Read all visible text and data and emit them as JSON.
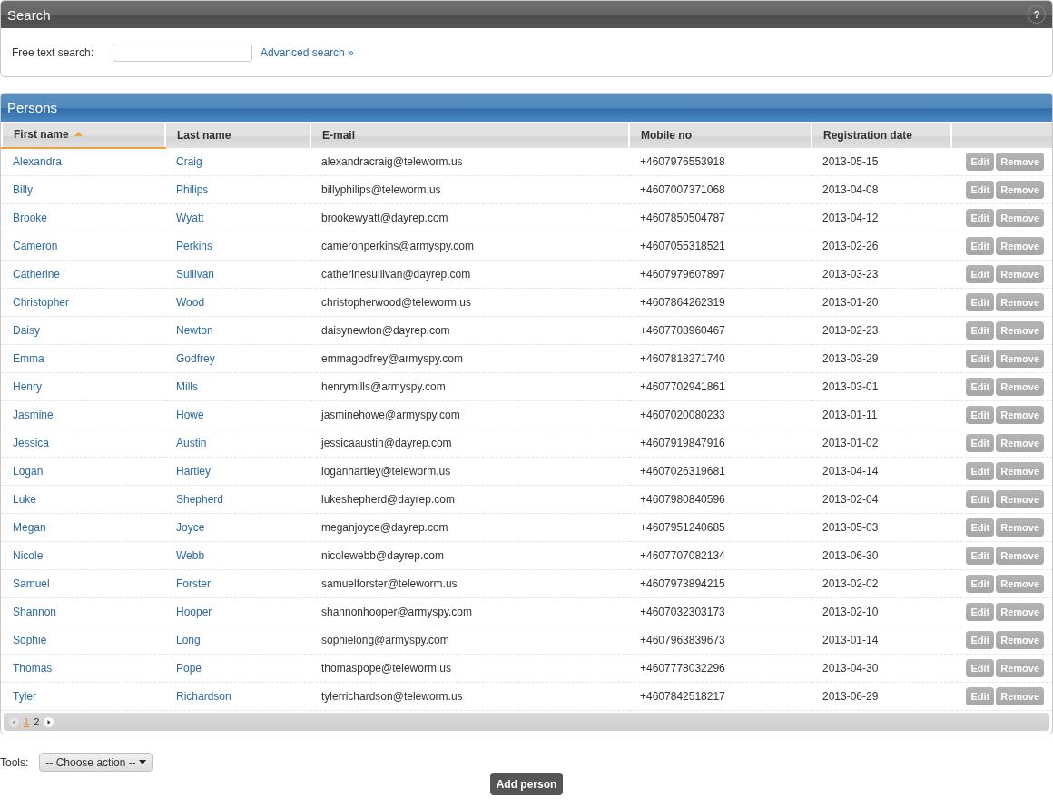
{
  "search_panel": {
    "title": "Search",
    "help": "?",
    "label": "Free text search:",
    "link": "Advanced search »"
  },
  "persons_panel": {
    "title": "Persons",
    "columns": [
      {
        "label": "First name",
        "sorted": true
      },
      {
        "label": "Last name",
        "sorted": false
      },
      {
        "label": "E-mail",
        "sorted": false
      },
      {
        "label": "Mobile no",
        "sorted": false
      },
      {
        "label": "Registration date",
        "sorted": false
      },
      {
        "sorted": false
      }
    ],
    "rows": [
      {
        "first": "Alexandra",
        "last": "Craig",
        "email": "alexandracraig@teleworm.us",
        "mobile": "+4607976553918",
        "date": "2013-05-15",
        "edit": "Edit",
        "remove": "Remove"
      },
      {
        "first": "Billy",
        "last": "Philips",
        "email": "billyphilips@teleworm.us",
        "mobile": "+4607007371068",
        "date": "2013-04-08",
        "edit": "Edit",
        "remove": "Remove"
      },
      {
        "first": "Brooke",
        "last": "Wyatt",
        "email": "brookewyatt@dayrep.com",
        "mobile": "+4607850504787",
        "date": "2013-04-12",
        "edit": "Edit",
        "remove": "Remove"
      },
      {
        "first": "Cameron",
        "last": "Perkins",
        "email": "cameronperkins@armyspy.com",
        "mobile": "+4607055318521",
        "date": "2013-02-26",
        "edit": "Edit",
        "remove": "Remove"
      },
      {
        "first": "Catherine",
        "last": "Sullivan",
        "email": "catherinesullivan@dayrep.com",
        "mobile": "+4607979607897",
        "date": "2013-03-23",
        "edit": "Edit",
        "remove": "Remove"
      },
      {
        "first": "Christopher",
        "last": "Wood",
        "email": "christopherwood@teleworm.us",
        "mobile": "+4607864262319",
        "date": "2013-01-20",
        "edit": "Edit",
        "remove": "Remove"
      },
      {
        "first": "Daisy",
        "last": "Newton",
        "email": "daisynewton@dayrep.com",
        "mobile": "+4607708960467",
        "date": "2013-02-23",
        "edit": "Edit",
        "remove": "Remove"
      },
      {
        "first": "Emma",
        "last": "Godfrey",
        "email": "emmagodfrey@armyspy.com",
        "mobile": "+4607818271740",
        "date": "2013-03-29",
        "edit": "Edit",
        "remove": "Remove"
      },
      {
        "first": "Henry",
        "last": "Mills",
        "email": "henrymills@armyspy.com",
        "mobile": "+4607702941861",
        "date": "2013-03-01",
        "edit": "Edit",
        "remove": "Remove"
      },
      {
        "first": "Jasmine",
        "last": "Howe",
        "email": "jasminehowe@armyspy.com",
        "mobile": "+4607020080233",
        "date": "2013-01-11",
        "edit": "Edit",
        "remove": "Remove"
      },
      {
        "first": "Jessica",
        "last": "Austin",
        "email": "jessicaaustin@dayrep.com",
        "mobile": "+4607919847916",
        "date": "2013-01-02",
        "edit": "Edit",
        "remove": "Remove"
      },
      {
        "first": "Logan",
        "last": "Hartley",
        "email": "loganhartley@teleworm.us",
        "mobile": "+4607026319681",
        "date": "2013-04-14",
        "edit": "Edit",
        "remove": "Remove"
      },
      {
        "first": "Luke",
        "last": "Shepherd",
        "email": "lukeshepherd@dayrep.com",
        "mobile": "+4607980840596",
        "date": "2013-02-04",
        "edit": "Edit",
        "remove": "Remove"
      },
      {
        "first": "Megan",
        "last": "Joyce",
        "email": "meganjoyce@dayrep.com",
        "mobile": "+4607951240685",
        "date": "2013-05-03",
        "edit": "Edit",
        "remove": "Remove"
      },
      {
        "first": "Nicole",
        "last": "Webb",
        "email": "nicolewebb@dayrep.com",
        "mobile": "+4607707082134",
        "date": "2013-06-30",
        "edit": "Edit",
        "remove": "Remove"
      },
      {
        "first": "Samuel",
        "last": "Forster",
        "email": "samuelforster@teleworm.us",
        "mobile": "+4607973894215",
        "date": "2013-02-02",
        "edit": "Edit",
        "remove": "Remove"
      },
      {
        "first": "Shannon",
        "last": "Hooper",
        "email": "shannonhooper@armyspy.com",
        "mobile": "+4607032303173",
        "date": "2013-02-10",
        "edit": "Edit",
        "remove": "Remove"
      },
      {
        "first": "Sophie",
        "last": "Long",
        "email": "sophielong@armyspy.com",
        "mobile": "+4607963839673",
        "date": "2013-01-14",
        "edit": "Edit",
        "remove": "Remove"
      },
      {
        "first": "Thomas",
        "last": "Pope",
        "email": "thomaspope@teleworm.us",
        "mobile": "+4607778032296",
        "date": "2013-04-30",
        "edit": "Edit",
        "remove": "Remove"
      },
      {
        "first": "Tyler",
        "last": "Richardson",
        "email": "tylerrichardson@teleworm.us",
        "mobile": "+4607842518217",
        "date": "2013-06-29",
        "edit": "Edit",
        "remove": "Remove"
      }
    ],
    "pages": [
      {
        "label": "1",
        "selected": true
      },
      {
        "label": "2",
        "selected": false
      }
    ]
  },
  "tools": {
    "label": "Tools:",
    "select": "-- Choose action --"
  },
  "add_button": "Add person"
}
